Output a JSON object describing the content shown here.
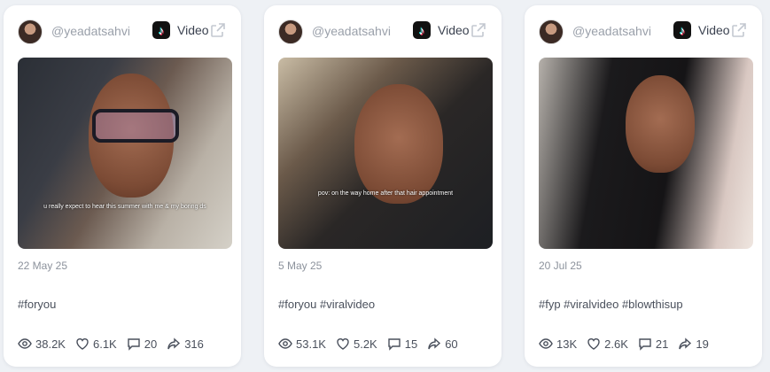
{
  "cards": [
    {
      "handle": "@yeadatsahvi",
      "platform_icon": "tiktok-icon",
      "type_label": "Video",
      "thumbnail_caption": "u really expect to hear this summer with me & my boring ds",
      "date": "22 May 25",
      "hashtags": "#foryou",
      "stats": {
        "views": "38.2K",
        "likes": "6.1K",
        "comments": "20",
        "shares": "316"
      }
    },
    {
      "handle": "@yeadatsahvi",
      "platform_icon": "tiktok-icon",
      "type_label": "Video",
      "thumbnail_caption": "pov: on the way home after that hair appointment",
      "date": "5 May 25",
      "hashtags": "#foryou #viralvideo",
      "stats": {
        "views": "53.1K",
        "likes": "5.2K",
        "comments": "15",
        "shares": "60"
      }
    },
    {
      "handle": "@yeadatsahvi",
      "platform_icon": "tiktok-icon",
      "type_label": "Video",
      "thumbnail_caption": "",
      "date": "20 Jul 25",
      "hashtags": "#fyp #viralvideo #blowthisup",
      "stats": {
        "views": "13K",
        "likes": "2.6K",
        "comments": "21",
        "shares": "19"
      }
    }
  ],
  "colors": {
    "background": "#eef1f5",
    "card": "#ffffff",
    "muted_text": "#9aa0aa",
    "text": "#4a505c"
  }
}
